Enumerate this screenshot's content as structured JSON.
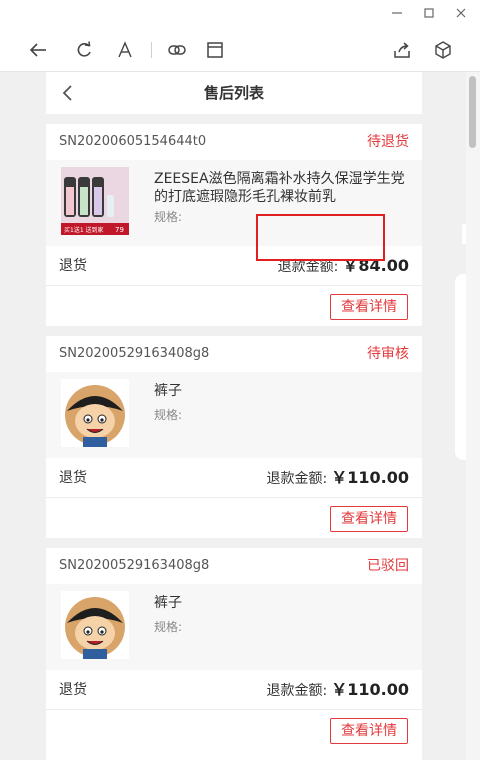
{
  "header": {
    "title": "售后列表"
  },
  "orders": [
    {
      "sn": "SN20200605154644t0",
      "status": "待退货",
      "product_name": "ZEESEA滋色隔离霜补水持久保湿学生党的打底遮瑕隐形毛孔裸妆前乳",
      "spec_label": "规格:",
      "thumb_text": {
        "promo": "买1送1 送到家",
        "price": "79"
      },
      "refund_type": "退货",
      "refund_label": "退款金额",
      "refund_amount": "￥84.00",
      "detail_label": "查看详情"
    },
    {
      "sn": "SN20200529163408g8",
      "status": "待审核",
      "product_name": "裤子",
      "spec_label": "规格:",
      "refund_type": "退货",
      "refund_label": "退款金额",
      "refund_amount": "￥110.00",
      "detail_label": "查看详情"
    },
    {
      "sn": "SN20200529163408g8",
      "status": "已驳回",
      "product_name": "裤子",
      "spec_label": "规格:",
      "refund_type": "退货",
      "refund_label": "退款金额",
      "refund_amount": "￥110.00",
      "detail_label": "查看详情"
    }
  ],
  "colors": {
    "accent": "#e4393c",
    "background": "#f0f0f0",
    "highlight": "#e02020"
  },
  "icons": [
    "minimize-icon",
    "maximize-icon",
    "close-icon",
    "back-arrow-icon",
    "refresh-icon",
    "font-icon",
    "link-icon",
    "window-icon",
    "share-icon",
    "cube-icon",
    "chevron-left-icon"
  ]
}
